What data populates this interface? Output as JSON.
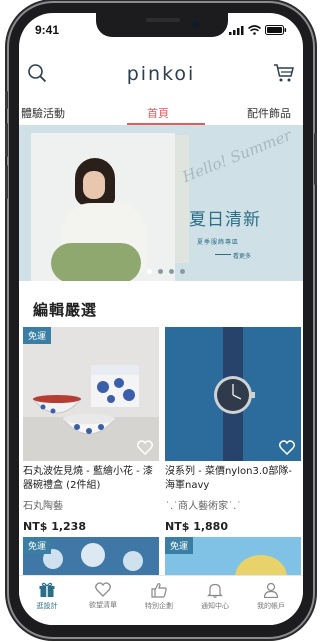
{
  "status_bar": {
    "time": "9:41"
  },
  "header": {
    "logo": "pinkoi"
  },
  "tabs": [
    {
      "label": "體驗活動"
    },
    {
      "label": "首頁"
    },
    {
      "label": "配件飾品"
    }
  ],
  "banner": {
    "script": "Hello! Summer",
    "title": "夏日清新",
    "subtitle": "夏季服飾專區",
    "more": "看更多",
    "slide_count": 4,
    "active_slide": 1
  },
  "section": {
    "title": "編輯嚴選"
  },
  "products": [
    {
      "badge": "免運",
      "title": "石丸波佐見燒 - 藍繪小花 - 漆器碗禮盒 (2件組)",
      "shop": "石丸陶藝",
      "price": "NT$ 1,238"
    },
    {
      "badge": "免運",
      "title": "沒系列 - 菜價nylon3.0部隊-海軍navy",
      "shop": "˙.˙商人藝術家˙.˙",
      "price": "NT$ 1,880"
    },
    {
      "badge": "免運"
    },
    {
      "badge": "免運"
    }
  ],
  "bottom_nav": [
    {
      "label": "逛設計",
      "icon": "gift-icon"
    },
    {
      "label": "欲望清單",
      "icon": "heart-icon"
    },
    {
      "label": "特別企劃",
      "icon": "thumbs-up-icon"
    },
    {
      "label": "通知中心",
      "icon": "bell-icon"
    },
    {
      "label": "我的帳戶",
      "icon": "user-icon"
    }
  ],
  "colors": {
    "accent": "#e05d5d",
    "brand": "#2c6e87",
    "badge": "#3a7fa3"
  }
}
